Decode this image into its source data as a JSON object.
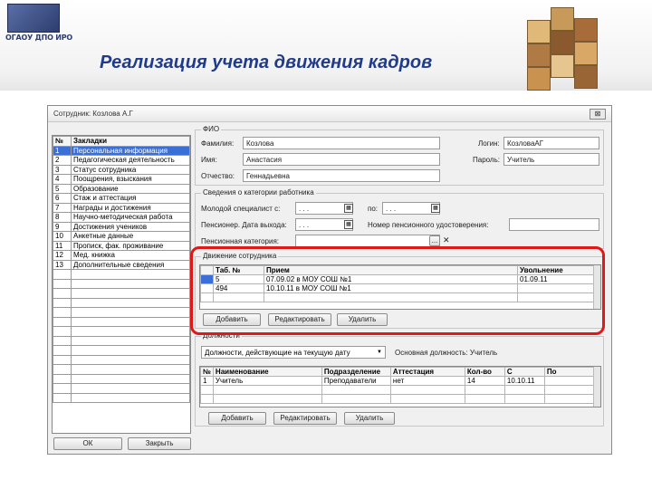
{
  "slide": {
    "logo_text": "ОГАОУ ДПО ИРО",
    "title": "Реализация учета движения кадров"
  },
  "window": {
    "title": "Сотрудник: Козлова А.Г",
    "close_label": "⊠"
  },
  "tabs": {
    "headers": [
      "№",
      "Закладки"
    ],
    "rows": [
      [
        "1",
        "Персональная информация"
      ],
      [
        "2",
        "Педагогическая деятельность"
      ],
      [
        "3",
        "Статус сотрудника"
      ],
      [
        "4",
        "Поощрения, взыскания"
      ],
      [
        "5",
        "Образование"
      ],
      [
        "6",
        "Стаж и аттестация"
      ],
      [
        "7",
        "Награды и достижения"
      ],
      [
        "8",
        "Научно-методическая работа"
      ],
      [
        "9",
        "Достижения учеников"
      ],
      [
        "10",
        "Анкетные данные"
      ],
      [
        "11",
        "Прописк, фак. проживание"
      ],
      [
        "12",
        "Мед. книжка"
      ],
      [
        "13",
        "Дополнительные сведения"
      ]
    ]
  },
  "fio": {
    "legend": "ФИО",
    "surname_label": "Фамилия:",
    "surname_value": "Козлова",
    "name_label": "Имя:",
    "name_value": "Анастасия",
    "patronymic_label": "Отчество:",
    "patronymic_value": "Геннадьевна",
    "login_label": "Логин:",
    "login_value": "КозловаАГ",
    "password_label": "Пароль:",
    "password_value": "Учитель"
  },
  "categories": {
    "legend": "Сведения о категории работника",
    "young_label": "Молодой специалист с:",
    "young_from": ". . .",
    "young_to_label": "по:",
    "young_to": ". . .",
    "pension_label": "Пенсионер. Дата выхода:",
    "pension_value": ". . .",
    "pension_cert_label": "Номер пенсионного удостоверения:",
    "pension_cert_value": "",
    "pension_cat_label": "Пенсионная категория:",
    "pension_cat_value": "",
    "more_btn": "...",
    "clear_btn": "✕"
  },
  "movement": {
    "legend": "Движение сотрудника",
    "headers": [
      "",
      "Таб. №",
      "Прием",
      "Увольнение"
    ],
    "rows": [
      [
        "",
        "5",
        "07.09.02 в МОУ СОШ №1",
        "01.09.11"
      ],
      [
        "",
        "494",
        "10.10.11 в МОУ СОШ №1",
        ""
      ],
      [
        "",
        "",
        "",
        ""
      ]
    ],
    "add_btn": "Добавить",
    "edit_btn": "Редактировать",
    "delete_btn": "Удалить"
  },
  "positions": {
    "legend": "Должности",
    "combo_value": "Должности, действующие на текущую дату",
    "main_label": "Основная должность: Учитель",
    "headers": [
      "№",
      "Наименование",
      "Подразделение",
      "Аттестация",
      "Кол-во",
      "С",
      "По"
    ],
    "rows": [
      [
        "1",
        "Учитель",
        "Преподаватели",
        "нет",
        "14",
        "10.10.11",
        ""
      ],
      [
        "",
        "",
        "",
        "",
        "",
        "",
        ""
      ],
      [
        "",
        "",
        "",
        "",
        "",
        "",
        ""
      ]
    ],
    "add_btn": "Добавить",
    "edit_btn": "Редактировать",
    "delete_btn": "Удалить"
  },
  "footer": {
    "ok_btn": "ОК",
    "close_btn": "Закрыть"
  },
  "colors": {
    "title": "#1f3b8a",
    "highlight_frame": "#e01818",
    "selection": "#3a6fd8"
  }
}
